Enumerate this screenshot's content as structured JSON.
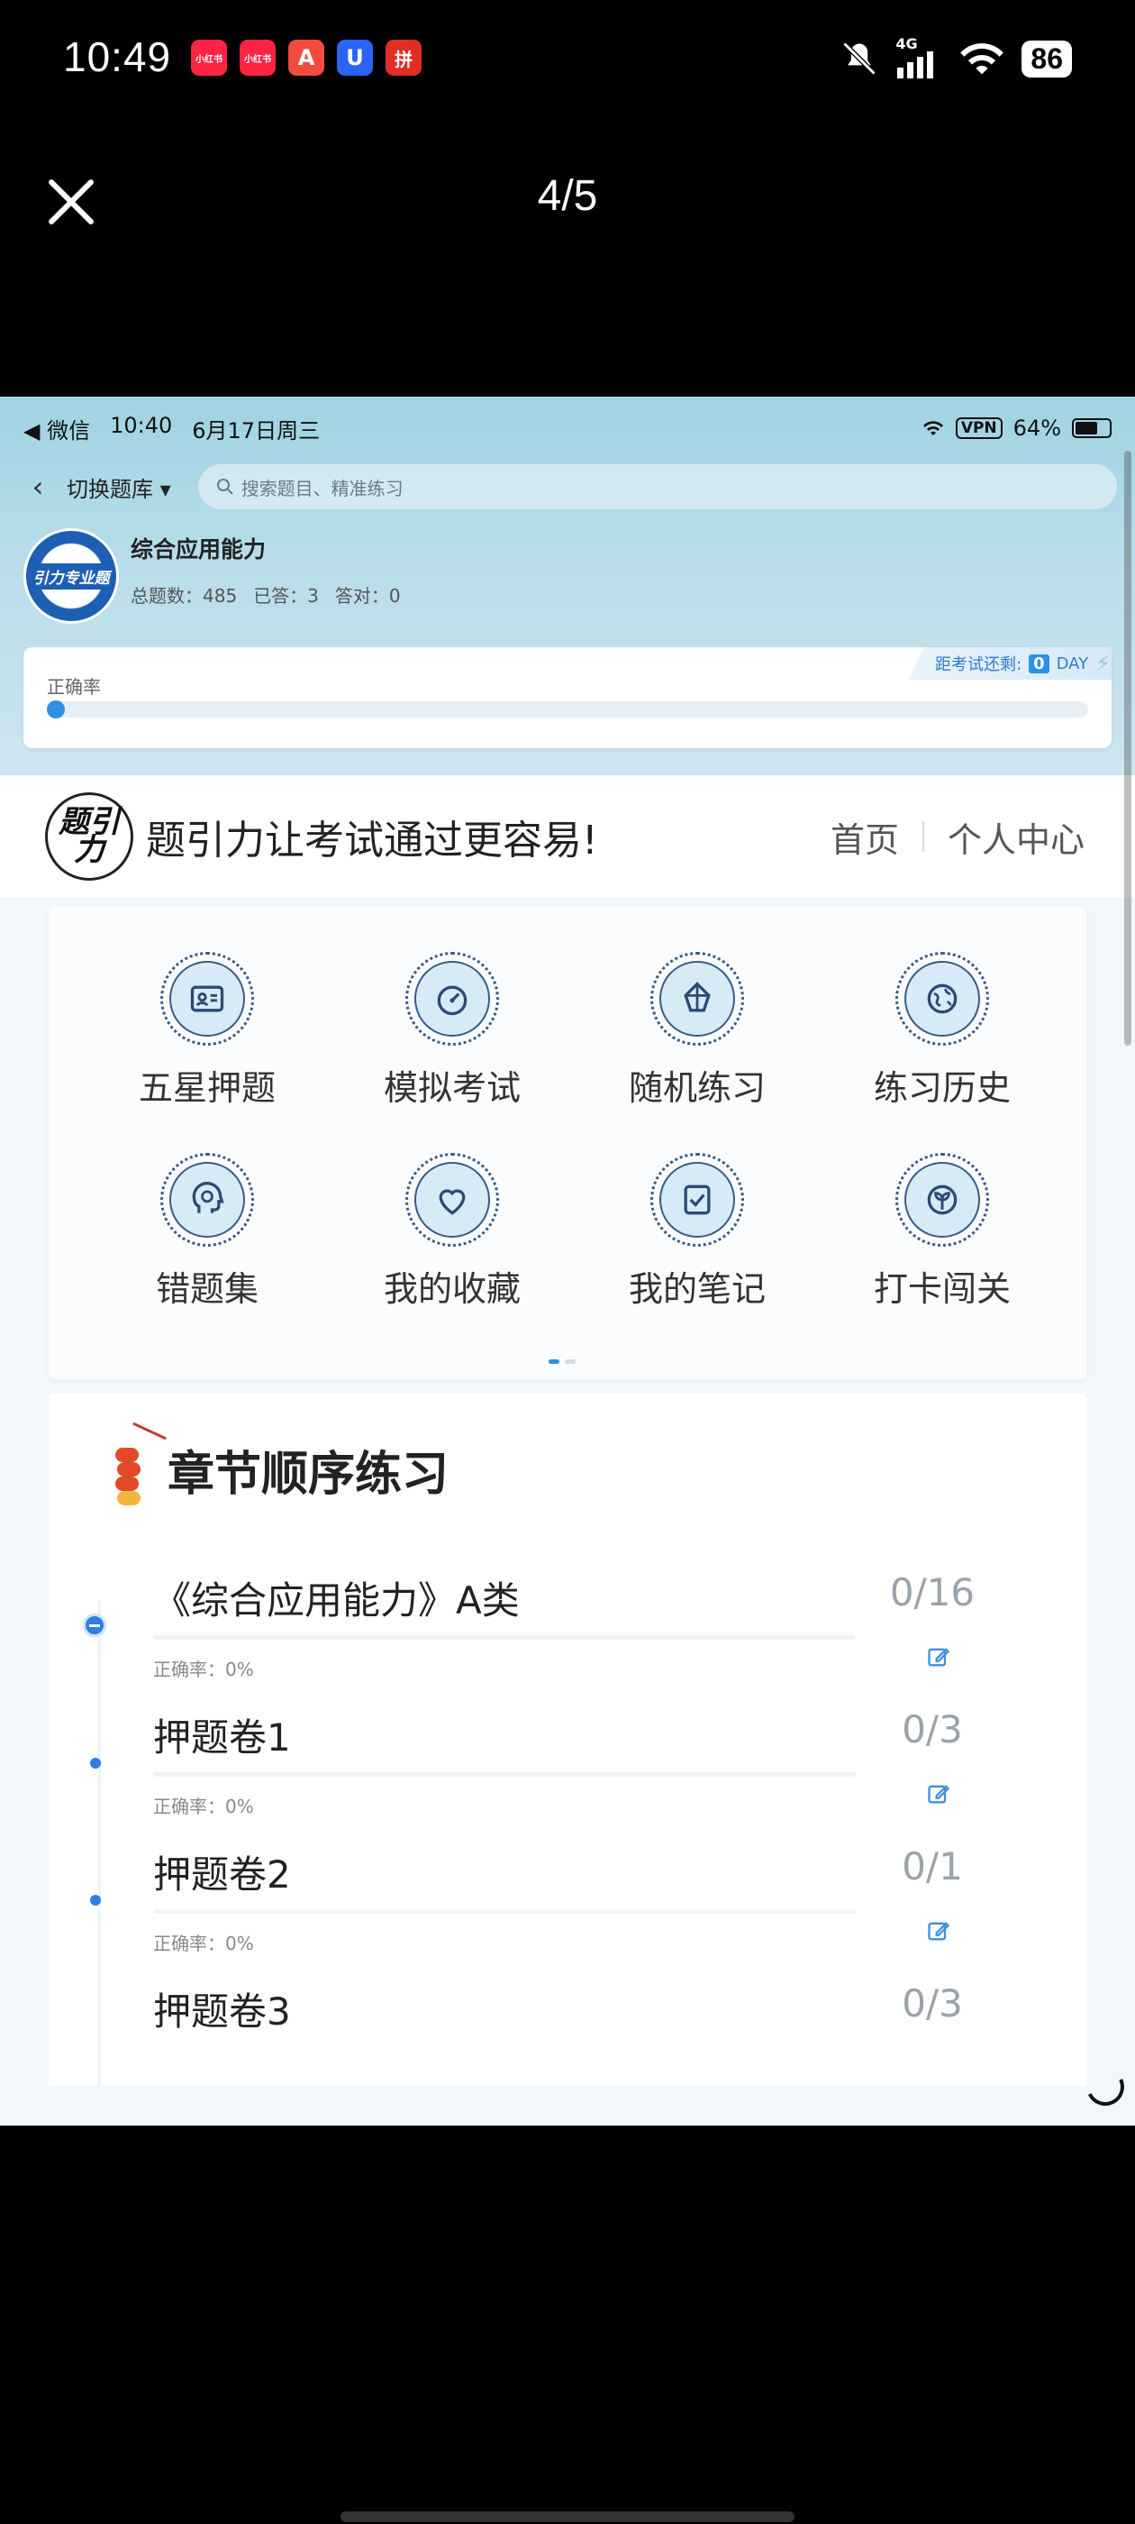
{
  "os_status": {
    "time": "10:49",
    "apps": [
      {
        "label": "小红书",
        "color": "#ff2442"
      },
      {
        "label": "小红书",
        "color": "#ff2442"
      },
      {
        "label": "A",
        "color": "#f04c3e"
      },
      {
        "label": "U",
        "color": "#2a64f6"
      },
      {
        "label": "拼",
        "color": "#e02e24"
      }
    ],
    "network": "4G",
    "battery": "86"
  },
  "viewer": {
    "counter": "4/5"
  },
  "inner_status": {
    "back_app": "◀ 微信",
    "time": "10:40",
    "date": "6月17日周三",
    "vpn": "VPN",
    "battery": "64%"
  },
  "nav": {
    "switch_label": "切换题库",
    "search_placeholder": "搜索题目、精准练习"
  },
  "bank": {
    "logo_text": "引力专业题",
    "title": "综合应用能力",
    "total": "总题数：485",
    "answered": "已答：3",
    "correct": "答对：0"
  },
  "accuracy": {
    "label": "正确率",
    "value_fraction": 0.0,
    "countdown_label": "距考试还剩:",
    "countdown_value": "0",
    "countdown_unit": "DAY"
  },
  "brand": {
    "logo_text": "题引力",
    "slogan": "题引力让考试通过更容易!",
    "nav": [
      "首页",
      "个人中心"
    ]
  },
  "features": [
    {
      "label": "五星押题",
      "icon": "id-card-icon"
    },
    {
      "label": "模拟考试",
      "icon": "speedometer-icon"
    },
    {
      "label": "随机练习",
      "icon": "shuffle-icon"
    },
    {
      "label": "练习历史",
      "icon": "globe-icon"
    },
    {
      "label": "错题集",
      "icon": "head-icon"
    },
    {
      "label": "我的收藏",
      "icon": "heart-icon"
    },
    {
      "label": "我的笔记",
      "icon": "note-check-icon"
    },
    {
      "label": "打卡闯关",
      "icon": "sprout-icon"
    }
  ],
  "accent_color": "#2e8fe6",
  "chapters": {
    "title": "章节顺序练习",
    "items": [
      {
        "name": "《综合应用能力》A类",
        "count": "0/16",
        "accuracy": "正确率：0%"
      },
      {
        "name": "押题卷1",
        "count": "0/3",
        "accuracy": "正确率：0%"
      },
      {
        "name": "押题卷2",
        "count": "0/1",
        "accuracy": "正确率：0%"
      },
      {
        "name": "押题卷3",
        "count": "0/3",
        "accuracy": ""
      }
    ]
  }
}
